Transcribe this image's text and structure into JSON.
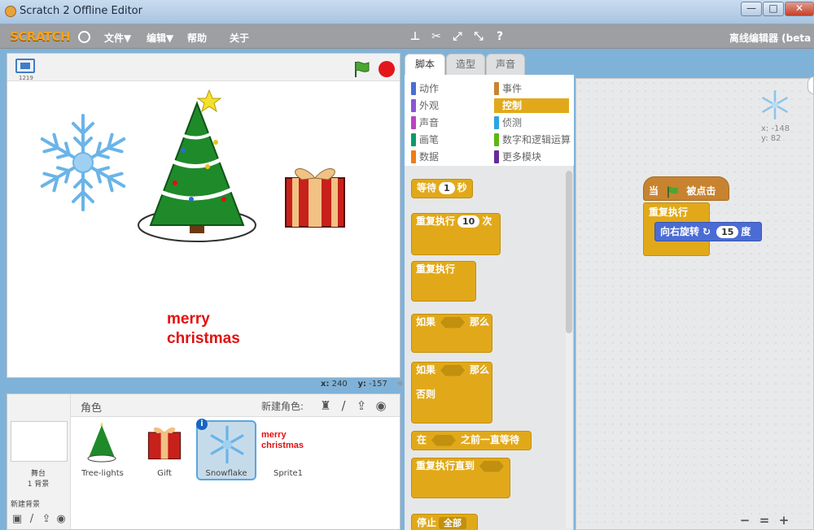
{
  "window": {
    "title": "Scratch 2 Offline Editor",
    "minimize": "—",
    "maximize": "□",
    "close": "✕"
  },
  "menubar": {
    "logo": "SCRATCH",
    "file": "文件▼",
    "edit": "编辑▼",
    "help": "帮助",
    "about": "关于",
    "offline_label": "离线编辑器 (beta"
  },
  "stage": {
    "mode_number": "1219",
    "merry_line1": "merry",
    "merry_line2": "christmas",
    "x_label": "x:",
    "x_value": "240",
    "y_label": "y:",
    "y_value": "-157"
  },
  "sprites_pane": {
    "title": "角色",
    "new_sprite_label": "新建角色:",
    "stage_label": "舞台",
    "stage_bg_count": "1 背景",
    "new_backdrop_label": "新建背景",
    "sprites": [
      {
        "name": "Tree-lights"
      },
      {
        "name": "Gift"
      },
      {
        "name": "Snowflake"
      },
      {
        "name": "Sprite1"
      }
    ],
    "sprite1_text_line1": "merry",
    "sprite1_text_line2": "christmas"
  },
  "tabs": [
    {
      "label": "脚本",
      "active": true
    },
    {
      "label": "造型",
      "active": false
    },
    {
      "label": "声音",
      "active": false
    }
  ],
  "categories": [
    {
      "label": "动作",
      "color": "#4a6cd4"
    },
    {
      "label": "事件",
      "color": "#c88330"
    },
    {
      "label": "外观",
      "color": "#8a55d7"
    },
    {
      "label": "控制",
      "color": "#e1a91a",
      "selected": true
    },
    {
      "label": "声音",
      "color": "#bb42c3"
    },
    {
      "label": "侦测",
      "color": "#2ca5e2"
    },
    {
      "label": "画笔",
      "color": "#0e9a6c"
    },
    {
      "label": "数字和逻辑运算",
      "color": "#5cb712"
    },
    {
      "label": "数据",
      "color": "#ee7d16"
    },
    {
      "label": "更多模块",
      "color": "#632d99"
    }
  ],
  "palette_blocks": {
    "wait_prefix": "等待",
    "wait_value": "1",
    "wait_suffix": "秒",
    "repeat_prefix": "重复执行",
    "repeat_value": "10",
    "repeat_suffix": "次",
    "forever": "重复执行",
    "if_prefix": "如果",
    "if_suffix": "那么",
    "if_else_prefix": "如果",
    "if_else_suffix": "那么",
    "else": "否则",
    "wait_until_prefix": "在",
    "wait_until_suffix": "之前一直等待",
    "repeat_until": "重复执行直到",
    "stop_prefix": "停止",
    "stop_value": "全部"
  },
  "script": {
    "hat_prefix": "当",
    "hat_suffix": "被点击",
    "forever": "重复执行",
    "turn_prefix": "向右旋转",
    "turn_value": "15",
    "turn_suffix": "度",
    "sprite_x": "x: -148",
    "sprite_y": "y: 82"
  },
  "zoom": {
    "out": "−",
    "reset": "=",
    "in": "+"
  }
}
